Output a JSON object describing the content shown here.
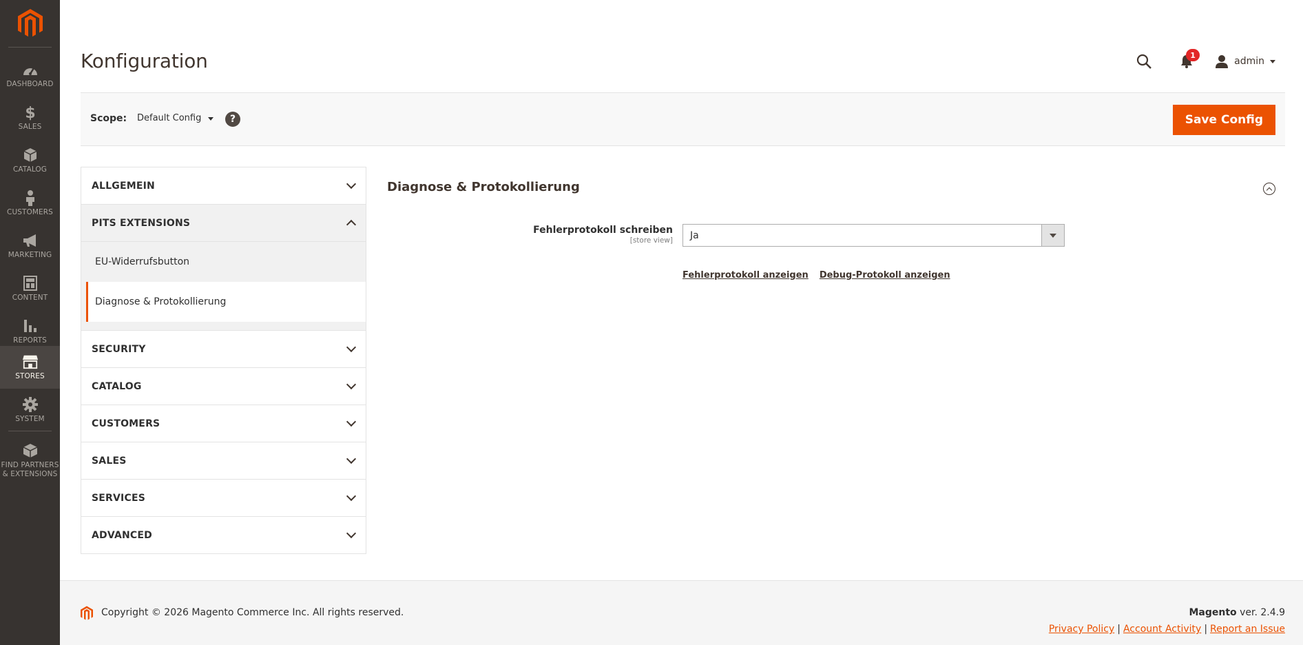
{
  "menu": {
    "items": [
      {
        "label": "DASHBOARD",
        "icon": "dashboard-icon"
      },
      {
        "label": "SALES",
        "icon": "dollar-icon"
      },
      {
        "label": "CATALOG",
        "icon": "box-icon"
      },
      {
        "label": "CUSTOMERS",
        "icon": "person-icon"
      },
      {
        "label": "MARKETING",
        "icon": "megaphone-icon"
      },
      {
        "label": "CONTENT",
        "icon": "layout-icon"
      },
      {
        "label": "REPORTS",
        "icon": "bar-chart-icon"
      },
      {
        "label": "STORES",
        "icon": "store-icon"
      },
      {
        "label": "SYSTEM",
        "icon": "gear-icon"
      },
      {
        "label": "FIND PARTNERS & EXTENSIONS",
        "icon": "cube-icon"
      }
    ],
    "active": "STORES"
  },
  "header": {
    "title": "Konfiguration",
    "notifications_count": "1",
    "account_name": "admin"
  },
  "scope": {
    "label": "Scope:",
    "value": "Default Config",
    "help": "?"
  },
  "actions": {
    "save_label": "Save Config"
  },
  "config_nav": {
    "allgemein": "ALLGEMEIN",
    "pits_extensions": "PITS EXTENSIONS",
    "pits_items": [
      "EU-Widerrufsbutton",
      "Diagnose & Protokollierung"
    ],
    "security": "SECURITY",
    "catalog": "CATALOG",
    "customers": "CUSTOMERS",
    "sales": "SALES",
    "services": "SERVICES",
    "advanced": "ADVANCED"
  },
  "section": {
    "title": "Diagnose & Protokollierung",
    "field_label": "Fehlerprotokoll schreiben",
    "field_scope": "[store view]",
    "field_value": "Ja",
    "link_error_log": "Fehlerprotokoll anzeigen",
    "link_debug_log": "Debug-Protokoll anzeigen"
  },
  "footer": {
    "copyright": "Copyright © 2026 Magento Commerce Inc. All rights reserved.",
    "brand": "Magento",
    "version": " ver. 2.4.9",
    "links": [
      "Privacy Policy",
      "Account Activity",
      "Report an Issue"
    ],
    "separator": "|"
  },
  "colors": {
    "accent": "#eb5202",
    "menu_bg": "#373330",
    "menu_text": "#aaa6a0"
  }
}
